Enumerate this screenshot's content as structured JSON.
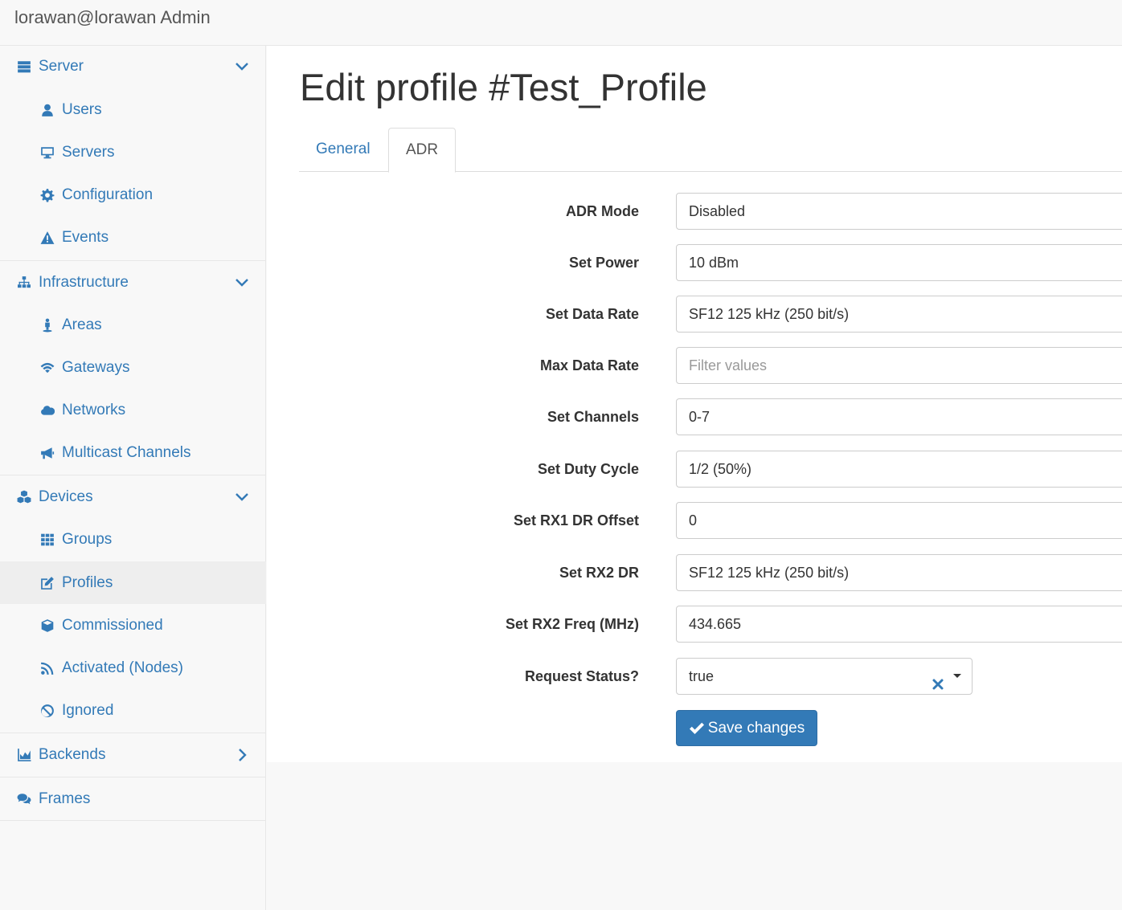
{
  "app": {
    "brand": "lorawan@lorawan Admin"
  },
  "sidebar": {
    "server": {
      "label": "Server",
      "icon": "server-icon"
    },
    "users": {
      "label": "Users",
      "icon": "user-icon"
    },
    "servers": {
      "label": "Servers",
      "icon": "desktop-icon"
    },
    "configuration": {
      "label": "Configuration",
      "icon": "gear-icon"
    },
    "events": {
      "label": "Events",
      "icon": "warning-icon"
    },
    "infrastructure": {
      "label": "Infrastructure",
      "icon": "sitemap-icon"
    },
    "areas": {
      "label": "Areas",
      "icon": "street-view-icon"
    },
    "gateways": {
      "label": "Gateways",
      "icon": "wifi-icon"
    },
    "networks": {
      "label": "Networks",
      "icon": "cloud-icon"
    },
    "multicast": {
      "label": "Multicast Channels",
      "icon": "bullhorn-icon"
    },
    "devices": {
      "label": "Devices",
      "icon": "cubes-icon"
    },
    "groups": {
      "label": "Groups",
      "icon": "grid-icon"
    },
    "profiles": {
      "label": "Profiles",
      "icon": "edit-icon"
    },
    "commissioned": {
      "label": "Commissioned",
      "icon": "cube-icon"
    },
    "activated": {
      "label": "Activated (Nodes)",
      "icon": "rss-icon"
    },
    "ignored": {
      "label": "Ignored",
      "icon": "ban-icon"
    },
    "backends": {
      "label": "Backends",
      "icon": "area-chart-icon"
    },
    "frames": {
      "label": "Frames",
      "icon": "comments-icon"
    }
  },
  "main": {
    "title": "Edit profile #Test_Profile",
    "tabs": [
      {
        "label": "General",
        "active": false
      },
      {
        "label": "ADR",
        "active": true
      }
    ],
    "fields": [
      {
        "label": "ADR Mode",
        "value": "Disabled"
      },
      {
        "label": "Set Power",
        "value": "10 dBm"
      },
      {
        "label": "Set Data Rate",
        "value": "SF12 125 kHz (250 bit/s)"
      },
      {
        "label": "Max Data Rate",
        "value": "",
        "placeholder": "Filter values"
      },
      {
        "label": "Set Channels",
        "value": "0-7"
      },
      {
        "label": "Set Duty Cycle",
        "value": "1/2 (50%)"
      },
      {
        "label": "Set RX1 DR Offset",
        "value": "0"
      },
      {
        "label": "Set RX2 DR",
        "value": "SF12 125 kHz (250 bit/s)"
      },
      {
        "label": "Set RX2 Freq (MHz)",
        "value": "434.665"
      },
      {
        "label": "Request Status?",
        "value": "true"
      }
    ],
    "save_label": "Save changes"
  },
  "colors": {
    "link": "#337ab7",
    "primary": "#337ab7",
    "clear": "#337ab7"
  }
}
